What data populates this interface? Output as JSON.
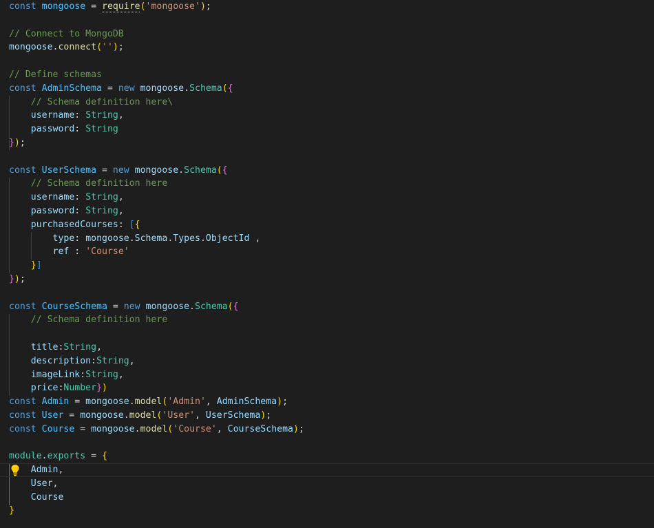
{
  "editor": {
    "language": "javascript",
    "theme_background": "#1e1e1e",
    "lines": [
      [
        {
          "c": "kw",
          "t": "const "
        },
        {
          "c": "var",
          "t": "mongoose"
        },
        {
          "c": "pun",
          "t": " = "
        },
        {
          "c": "fn squiggle",
          "t": "require"
        },
        {
          "c": "b1",
          "t": "("
        },
        {
          "c": "str",
          "t": "'mongoose'"
        },
        {
          "c": "b1",
          "t": ")"
        },
        {
          "c": "pun",
          "t": ";"
        }
      ],
      [],
      [
        {
          "c": "cmt",
          "t": "// Connect to MongoDB"
        }
      ],
      [
        {
          "c": "prop",
          "t": "mongoose"
        },
        {
          "c": "pun",
          "t": "."
        },
        {
          "c": "fn",
          "t": "connect"
        },
        {
          "c": "b1",
          "t": "("
        },
        {
          "c": "str",
          "t": "''"
        },
        {
          "c": "b1",
          "t": ")"
        },
        {
          "c": "pun",
          "t": ";"
        }
      ],
      [],
      [
        {
          "c": "cmt",
          "t": "// Define schemas"
        }
      ],
      [
        {
          "c": "kw",
          "t": "const "
        },
        {
          "c": "var",
          "t": "AdminSchema"
        },
        {
          "c": "pun",
          "t": " = "
        },
        {
          "c": "kw",
          "t": "new "
        },
        {
          "c": "prop",
          "t": "mongoose"
        },
        {
          "c": "pun",
          "t": "."
        },
        {
          "c": "cls",
          "t": "Schema"
        },
        {
          "c": "b1",
          "t": "("
        },
        {
          "c": "b2",
          "t": "{"
        }
      ],
      [
        {
          "c": "pun",
          "t": "    "
        },
        {
          "c": "cmt",
          "t": "// Schema definition here\\"
        }
      ],
      [
        {
          "c": "pun",
          "t": "    "
        },
        {
          "c": "prop",
          "t": "username"
        },
        {
          "c": "pun",
          "t": ": "
        },
        {
          "c": "cls",
          "t": "String"
        },
        {
          "c": "pun",
          "t": ","
        }
      ],
      [
        {
          "c": "pun",
          "t": "    "
        },
        {
          "c": "prop",
          "t": "password"
        },
        {
          "c": "pun",
          "t": ": "
        },
        {
          "c": "cls",
          "t": "String"
        }
      ],
      [
        {
          "c": "b2",
          "t": "}"
        },
        {
          "c": "b1",
          "t": ")"
        },
        {
          "c": "pun",
          "t": ";"
        }
      ],
      [],
      [
        {
          "c": "kw",
          "t": "const "
        },
        {
          "c": "var",
          "t": "UserSchema"
        },
        {
          "c": "pun",
          "t": " = "
        },
        {
          "c": "kw",
          "t": "new "
        },
        {
          "c": "prop",
          "t": "mongoose"
        },
        {
          "c": "pun",
          "t": "."
        },
        {
          "c": "cls",
          "t": "Schema"
        },
        {
          "c": "b1",
          "t": "("
        },
        {
          "c": "b2",
          "t": "{"
        }
      ],
      [
        {
          "c": "pun",
          "t": "    "
        },
        {
          "c": "cmt",
          "t": "// Schema definition here"
        }
      ],
      [
        {
          "c": "pun",
          "t": "    "
        },
        {
          "c": "prop",
          "t": "username"
        },
        {
          "c": "pun",
          "t": ": "
        },
        {
          "c": "cls",
          "t": "String"
        },
        {
          "c": "pun",
          "t": ","
        }
      ],
      [
        {
          "c": "pun",
          "t": "    "
        },
        {
          "c": "prop",
          "t": "password"
        },
        {
          "c": "pun",
          "t": ": "
        },
        {
          "c": "cls",
          "t": "String"
        },
        {
          "c": "pun",
          "t": ","
        }
      ],
      [
        {
          "c": "pun",
          "t": "    "
        },
        {
          "c": "prop",
          "t": "purchasedCourses"
        },
        {
          "c": "pun",
          "t": ": "
        },
        {
          "c": "b3",
          "t": "["
        },
        {
          "c": "b1",
          "t": "{"
        }
      ],
      [
        {
          "c": "pun",
          "t": "        "
        },
        {
          "c": "prop",
          "t": "type"
        },
        {
          "c": "pun",
          "t": ": "
        },
        {
          "c": "prop",
          "t": "mongoose"
        },
        {
          "c": "pun",
          "t": "."
        },
        {
          "c": "prop",
          "t": "Schema"
        },
        {
          "c": "pun",
          "t": "."
        },
        {
          "c": "prop",
          "t": "Types"
        },
        {
          "c": "pun",
          "t": "."
        },
        {
          "c": "prop",
          "t": "ObjectId"
        },
        {
          "c": "pun",
          "t": " ,"
        }
      ],
      [
        {
          "c": "pun",
          "t": "        "
        },
        {
          "c": "prop",
          "t": "ref"
        },
        {
          "c": "pun",
          "t": " : "
        },
        {
          "c": "str",
          "t": "'Course'"
        }
      ],
      [
        {
          "c": "pun",
          "t": "    "
        },
        {
          "c": "b1",
          "t": "}"
        },
        {
          "c": "b3",
          "t": "]"
        }
      ],
      [
        {
          "c": "b2",
          "t": "}"
        },
        {
          "c": "b1",
          "t": ")"
        },
        {
          "c": "pun",
          "t": ";"
        }
      ],
      [],
      [
        {
          "c": "kw",
          "t": "const "
        },
        {
          "c": "var",
          "t": "CourseSchema"
        },
        {
          "c": "pun",
          "t": " = "
        },
        {
          "c": "kw",
          "t": "new "
        },
        {
          "c": "prop",
          "t": "mongoose"
        },
        {
          "c": "pun",
          "t": "."
        },
        {
          "c": "cls",
          "t": "Schema"
        },
        {
          "c": "b1",
          "t": "("
        },
        {
          "c": "b2",
          "t": "{"
        }
      ],
      [
        {
          "c": "pun",
          "t": "    "
        },
        {
          "c": "cmt",
          "t": "// Schema definition here"
        }
      ],
      [],
      [
        {
          "c": "pun",
          "t": "    "
        },
        {
          "c": "prop",
          "t": "title"
        },
        {
          "c": "pun",
          "t": ":"
        },
        {
          "c": "cls",
          "t": "String"
        },
        {
          "c": "pun",
          "t": ","
        }
      ],
      [
        {
          "c": "pun",
          "t": "    "
        },
        {
          "c": "prop",
          "t": "description"
        },
        {
          "c": "pun",
          "t": ":"
        },
        {
          "c": "cls",
          "t": "String"
        },
        {
          "c": "pun",
          "t": ","
        }
      ],
      [
        {
          "c": "pun",
          "t": "    "
        },
        {
          "c": "prop",
          "t": "imageLink"
        },
        {
          "c": "pun",
          "t": ":"
        },
        {
          "c": "cls",
          "t": "String"
        },
        {
          "c": "pun",
          "t": ","
        }
      ],
      [
        {
          "c": "pun",
          "t": "    "
        },
        {
          "c": "prop",
          "t": "price"
        },
        {
          "c": "pun",
          "t": ":"
        },
        {
          "c": "cls",
          "t": "Number"
        },
        {
          "c": "b2",
          "t": "}"
        },
        {
          "c": "b1",
          "t": ")"
        }
      ],
      [
        {
          "c": "kw",
          "t": "const "
        },
        {
          "c": "var",
          "t": "Admin"
        },
        {
          "c": "pun",
          "t": " = "
        },
        {
          "c": "prop",
          "t": "mongoose"
        },
        {
          "c": "pun",
          "t": "."
        },
        {
          "c": "fn",
          "t": "model"
        },
        {
          "c": "b1",
          "t": "("
        },
        {
          "c": "str",
          "t": "'Admin'"
        },
        {
          "c": "pun",
          "t": ", "
        },
        {
          "c": "prop",
          "t": "AdminSchema"
        },
        {
          "c": "b1",
          "t": ")"
        },
        {
          "c": "pun",
          "t": ";"
        }
      ],
      [
        {
          "c": "kw",
          "t": "const "
        },
        {
          "c": "var",
          "t": "User"
        },
        {
          "c": "pun",
          "t": " = "
        },
        {
          "c": "prop",
          "t": "mongoose"
        },
        {
          "c": "pun",
          "t": "."
        },
        {
          "c": "fn",
          "t": "model"
        },
        {
          "c": "b1",
          "t": "("
        },
        {
          "c": "str",
          "t": "'User'"
        },
        {
          "c": "pun",
          "t": ", "
        },
        {
          "c": "prop",
          "t": "UserSchema"
        },
        {
          "c": "b1",
          "t": ")"
        },
        {
          "c": "pun",
          "t": ";"
        }
      ],
      [
        {
          "c": "kw",
          "t": "const "
        },
        {
          "c": "var",
          "t": "Course"
        },
        {
          "c": "pun",
          "t": " = "
        },
        {
          "c": "prop",
          "t": "mongoose"
        },
        {
          "c": "pun",
          "t": "."
        },
        {
          "c": "fn",
          "t": "model"
        },
        {
          "c": "b1",
          "t": "("
        },
        {
          "c": "str",
          "t": "'Course'"
        },
        {
          "c": "pun",
          "t": ", "
        },
        {
          "c": "prop",
          "t": "CourseSchema"
        },
        {
          "c": "b1",
          "t": ")"
        },
        {
          "c": "pun",
          "t": ";"
        }
      ],
      [],
      [
        {
          "c": "cls",
          "t": "module"
        },
        {
          "c": "pun",
          "t": "."
        },
        {
          "c": "cls",
          "t": "exports"
        },
        {
          "c": "pun",
          "t": " = "
        },
        {
          "c": "b1",
          "t": "{"
        }
      ],
      [
        {
          "c": "pun",
          "t": "    "
        },
        {
          "c": "prop",
          "t": "Admin"
        },
        {
          "c": "pun",
          "t": ","
        }
      ],
      [
        {
          "c": "pun",
          "t": "    "
        },
        {
          "c": "prop",
          "t": "User"
        },
        {
          "c": "pun",
          "t": ","
        }
      ],
      [
        {
          "c": "pun",
          "t": "    "
        },
        {
          "c": "prop",
          "t": "Course"
        }
      ],
      [
        {
          "c": "b1",
          "t": "}"
        }
      ]
    ],
    "active_line": 34,
    "icons": {
      "lightbulb": "lightbulb-icon",
      "lightbulb_color": "#ffcc00"
    }
  }
}
